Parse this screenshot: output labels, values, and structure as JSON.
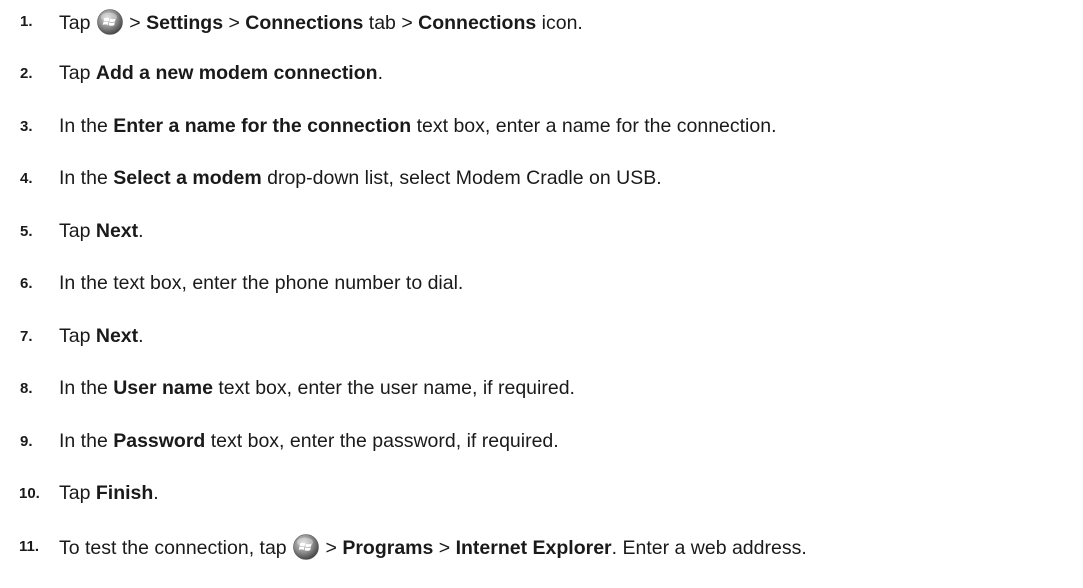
{
  "steps": [
    {
      "num": "1.",
      "parts": [
        "Tap",
        "> ",
        "Settings",
        " > ",
        "Connections",
        " tab > ",
        "Connections",
        " icon."
      ]
    },
    {
      "num": "2.",
      "parts": [
        "Tap ",
        "Add a new modem connection",
        "."
      ]
    },
    {
      "num": "3.",
      "parts": [
        "In the ",
        "Enter a name for the connection",
        " text box, enter a name for the connection."
      ]
    },
    {
      "num": "4.",
      "parts": [
        "In the ",
        "Select a modem",
        " drop-down list, select Modem Cradle on USB."
      ]
    },
    {
      "num": "5.",
      "parts": [
        "Tap ",
        "Next",
        "."
      ]
    },
    {
      "num": "6.",
      "parts": [
        "In the text box, enter the phone number to dial."
      ]
    },
    {
      "num": "7.",
      "parts": [
        "Tap ",
        "Next",
        "."
      ]
    },
    {
      "num": "8.",
      "parts": [
        "In the ",
        "User name",
        " text box, enter the user name, if required."
      ]
    },
    {
      "num": "9.",
      "parts": [
        "In the ",
        "Password",
        " text box, enter the password, if required."
      ]
    },
    {
      "num": "10.",
      "parts": [
        "Tap ",
        "Finish",
        "."
      ]
    },
    {
      "num": "11.",
      "parts": [
        "To test the connection, tap",
        "> ",
        "Programs",
        " > ",
        "Internet Explorer",
        ". Enter a web address."
      ]
    }
  ],
  "icons": {
    "start_icon": "windows-start-icon"
  }
}
